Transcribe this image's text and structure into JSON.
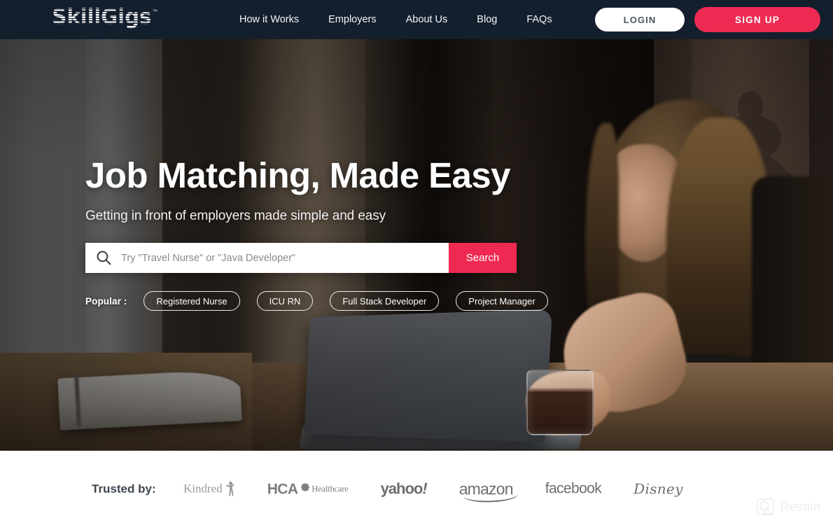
{
  "header": {
    "logo": {
      "text": "SkillGigs",
      "trademark": "™",
      "icon": "skillgigs-logo"
    },
    "nav": [
      {
        "label": "How it Works",
        "name": "how-it-works"
      },
      {
        "label": "Employers",
        "name": "employers"
      },
      {
        "label": "About Us",
        "name": "about-us"
      },
      {
        "label": "Blog",
        "name": "blog"
      },
      {
        "label": "FAQs",
        "name": "faqs"
      }
    ],
    "login_label": "LOGIN",
    "signup_label": "SIGN UP",
    "background_color": "#141f2e",
    "accent_color": "#ee2a52"
  },
  "hero": {
    "title": "Job Matching, Made Easy",
    "subtitle": "Getting in front of employers made simple and easy",
    "search": {
      "placeholder": "Try \"Travel Nurse\" or \"Java Developer\"",
      "value": "",
      "button_label": "Search",
      "icon": "search-icon",
      "button_color": "#ee2a52"
    },
    "popular_label": "Popular :",
    "popular_tags": [
      "Registered Nurse",
      "ICU RN",
      "Full Stack Developer",
      "Project Manager"
    ]
  },
  "trusted": {
    "label": "Trusted by:",
    "logos": [
      {
        "name": "kindred",
        "text": "Kindred"
      },
      {
        "name": "hca-healthcare",
        "text_top": "HCA",
        "text_bottom": "Healthcare"
      },
      {
        "name": "yahoo",
        "text": "yahoo",
        "suffix": "!"
      },
      {
        "name": "amazon",
        "text": "amazon"
      },
      {
        "name": "facebook",
        "text": "facebook"
      },
      {
        "name": "disney",
        "text": "Disney"
      }
    ]
  },
  "watermark": {
    "text": "Revain",
    "icon": "revain-logo"
  }
}
